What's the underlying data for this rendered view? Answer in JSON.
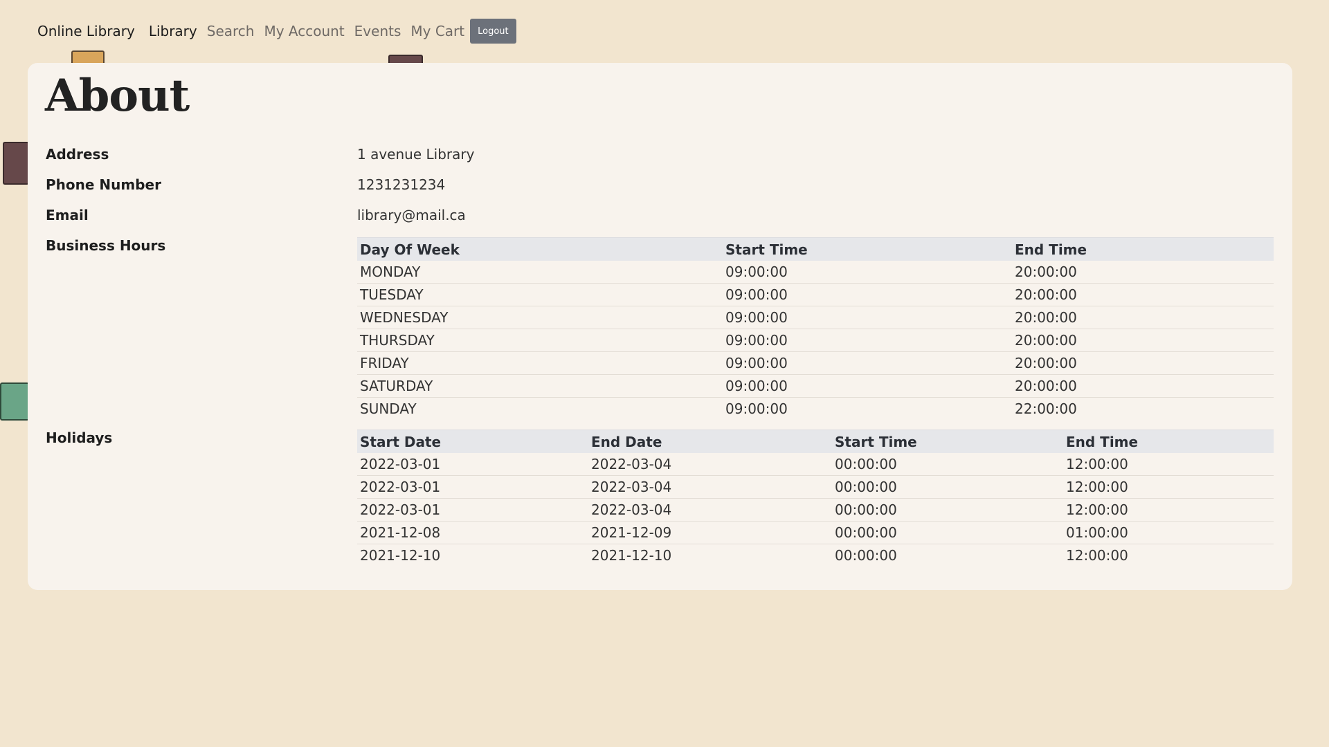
{
  "nav": {
    "brand": "Online Library",
    "links": [
      {
        "label": "Library",
        "active": true
      },
      {
        "label": "Search",
        "active": false
      },
      {
        "label": "My Account",
        "active": false
      },
      {
        "label": "Events",
        "active": false
      },
      {
        "label": "My Cart",
        "active": false
      }
    ],
    "logout_label": "Logout"
  },
  "page": {
    "title": "About",
    "address_label": "Address",
    "address_value": "1 avenue Library",
    "phone_label": "Phone Number",
    "phone_value": "1231231234",
    "email_label": "Email",
    "email_value": "library@mail.ca",
    "hours_label": "Business Hours",
    "holidays_label": "Holidays"
  },
  "business_hours": {
    "headers": [
      "Day Of Week",
      "Start Time",
      "End Time"
    ],
    "rows": [
      [
        "MONDAY",
        "09:00:00",
        "20:00:00"
      ],
      [
        "TUESDAY",
        "09:00:00",
        "20:00:00"
      ],
      [
        "WEDNESDAY",
        "09:00:00",
        "20:00:00"
      ],
      [
        "THURSDAY",
        "09:00:00",
        "20:00:00"
      ],
      [
        "FRIDAY",
        "09:00:00",
        "20:00:00"
      ],
      [
        "SATURDAY",
        "09:00:00",
        "20:00:00"
      ],
      [
        "SUNDAY",
        "09:00:00",
        "22:00:00"
      ]
    ]
  },
  "holidays": {
    "headers": [
      "Start Date",
      "End Date",
      "Start Time",
      "End Time"
    ],
    "rows": [
      [
        "2022-03-01",
        "2022-03-04",
        "00:00:00",
        "12:00:00"
      ],
      [
        "2022-03-01",
        "2022-03-04",
        "00:00:00",
        "12:00:00"
      ],
      [
        "2022-03-01",
        "2022-03-04",
        "00:00:00",
        "12:00:00"
      ],
      [
        "2021-12-08",
        "2021-12-09",
        "00:00:00",
        "01:00:00"
      ],
      [
        "2021-12-10",
        "2021-12-10",
        "00:00:00",
        "12:00:00"
      ]
    ]
  },
  "colors": {
    "background": "#f2e5cf",
    "card": "#f8f3ed",
    "table_header": "#e6e7ea",
    "logout_button": "#6c717a"
  }
}
